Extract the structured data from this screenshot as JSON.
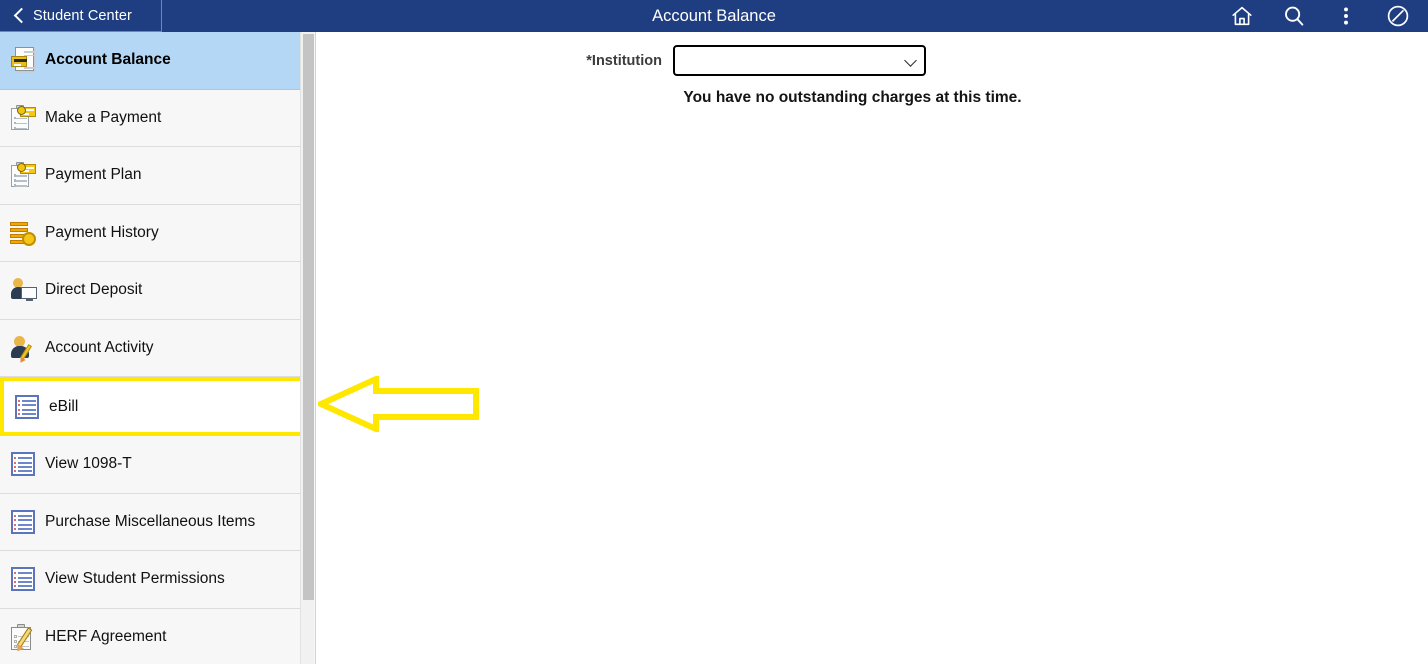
{
  "header": {
    "back_label": "Student Center",
    "back_icon": "chevron-left-icon",
    "title": "Account Balance",
    "icons": [
      {
        "name": "home-icon",
        "glyph": "home"
      },
      {
        "name": "search-icon",
        "glyph": "search"
      },
      {
        "name": "more-vertical-icon",
        "glyph": "kebab"
      },
      {
        "name": "no-entry-icon",
        "glyph": "compass"
      }
    ],
    "bg_color": "#1f3e82",
    "text_color": "#ffffff"
  },
  "sidebar": {
    "active_index": 0,
    "highlighted_index": 6,
    "active_bg_color": "#b3d7f5",
    "highlight_border_color": "#ffe700",
    "items": [
      {
        "label": "Account Balance",
        "icon": "document-card-icon"
      },
      {
        "label": "Make a Payment",
        "icon": "clipboard-payment-icon"
      },
      {
        "label": "Payment Plan",
        "icon": "clipboard-payment-icon"
      },
      {
        "label": "Payment History",
        "icon": "coins-history-icon"
      },
      {
        "label": "Direct Deposit",
        "icon": "person-monitor-icon"
      },
      {
        "label": "Account Activity",
        "icon": "person-pencil-icon"
      },
      {
        "label": "eBill",
        "icon": "list-lines-icon"
      },
      {
        "label": "View 1098-T",
        "icon": "list-lines-icon"
      },
      {
        "label": "Purchase Miscellaneous Items",
        "icon": "list-lines-icon"
      },
      {
        "label": "View Student Permissions",
        "icon": "list-lines-icon"
      },
      {
        "label": "HERF Agreement",
        "icon": "clipboard-pencil-icon"
      }
    ],
    "scrollbar": {
      "name": "sidebar-scrollbar",
      "thumb_color": "#c4c4c4"
    }
  },
  "main": {
    "institution_label": "*Institution",
    "institution_value": "",
    "institution_options": [
      ""
    ],
    "message": "You have no outstanding charges at this time."
  },
  "annotation": {
    "arrow": {
      "name": "annotation-arrow-left",
      "color": "#ffe700",
      "direction": "left"
    }
  }
}
